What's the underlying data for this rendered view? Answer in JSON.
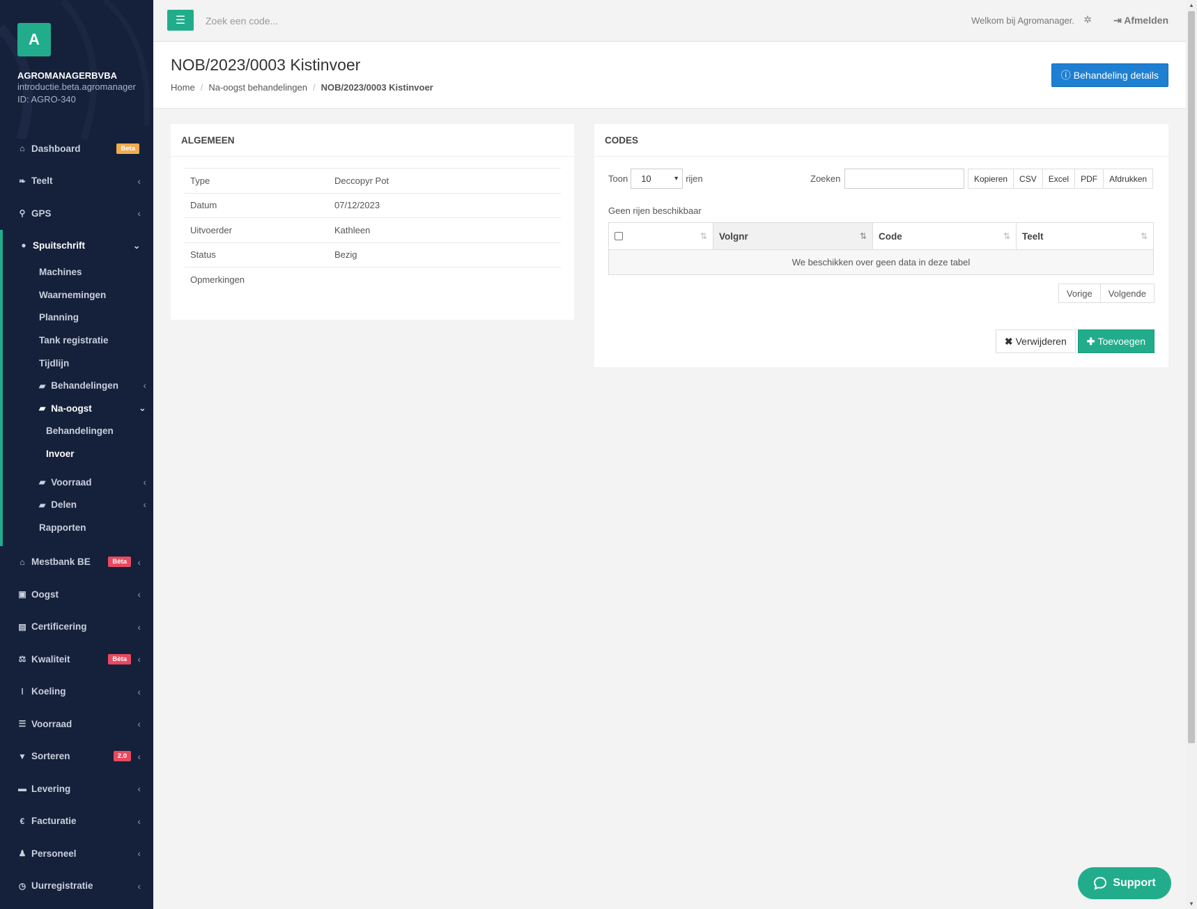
{
  "topbar": {
    "search_placeholder": "Zoek een code...",
    "welcome": "Welkom bij Agromanager.",
    "logout": "Afmelden"
  },
  "brand": {
    "logo_letter": "A",
    "company": "AGROMANAGERBVBA",
    "domain": "introductie.beta.agromanager",
    "id": "ID: AGRO-340"
  },
  "sidebar": {
    "top_items": [
      {
        "label": "Dashboard",
        "badge": "Beta"
      },
      {
        "label": "Teelt"
      },
      {
        "label": "GPS"
      }
    ],
    "open_section": {
      "label": "Spuitschrift",
      "items": [
        "Machines",
        "Waarnemingen",
        "Planning",
        "Tank registratie",
        "Tijdlijn"
      ],
      "folder_behandelingen": "Behandelingen",
      "folder_naoogst": "Na-oogst",
      "naoogst_children": [
        "Behandelingen",
        "Invoer"
      ],
      "folder_voorraad": "Voorraad",
      "folder_delen": "Delen",
      "rapporten": "Rapporten"
    },
    "bottom_items": [
      {
        "label": "Mestbank BE",
        "badge": "Bèta"
      },
      {
        "label": "Oogst"
      },
      {
        "label": "Certificering"
      },
      {
        "label": "Kwaliteit",
        "badge": "Bèta"
      },
      {
        "label": "Koeling"
      },
      {
        "label": "Voorraad"
      },
      {
        "label": "Sorteren",
        "badge": "2.0"
      },
      {
        "label": "Levering"
      },
      {
        "label": "Facturatie"
      },
      {
        "label": "Personeel"
      },
      {
        "label": "Uurregistratie"
      }
    ]
  },
  "page": {
    "title": "NOB/2023/0003 Kistinvoer",
    "breadcrumb": [
      "Home",
      "Na-oogst behandelingen",
      "NOB/2023/0003 Kistinvoer"
    ],
    "details_button": "Behandeling details"
  },
  "general": {
    "header": "ALGEMEEN",
    "rows": [
      {
        "key": "Type",
        "value": "Deccopyr Pot"
      },
      {
        "key": "Datum",
        "value": "07/12/2023"
      },
      {
        "key": "Uitvoerder",
        "value": "Kathleen"
      },
      {
        "key": "Status",
        "value": "Bezig"
      },
      {
        "key": "Opmerkingen",
        "value": ""
      }
    ]
  },
  "codes": {
    "header": "CODES",
    "show_label": "Toon",
    "rows_label": "rijen",
    "page_size": "10",
    "search_label": "Zoeken",
    "export_buttons": [
      "Kopieren",
      "CSV",
      "Excel",
      "PDF",
      "Afdrukken"
    ],
    "no_rows": "Geen rijen beschikbaar",
    "columns": [
      "",
      "Volgnr",
      "Code",
      "Teelt"
    ],
    "empty_message": "We beschikken over geen data in deze tabel",
    "prev": "Vorige",
    "next": "Volgende",
    "delete_button": "Verwijderen",
    "add_button": "Toevoegen"
  },
  "support": {
    "label": "Support"
  },
  "colors": {
    "accent": "#21ad8b",
    "sidebar": "#15203a",
    "primary": "#1f7fd1",
    "badge_orange": "#f0ad4e",
    "badge_red": "#e84a5f"
  }
}
